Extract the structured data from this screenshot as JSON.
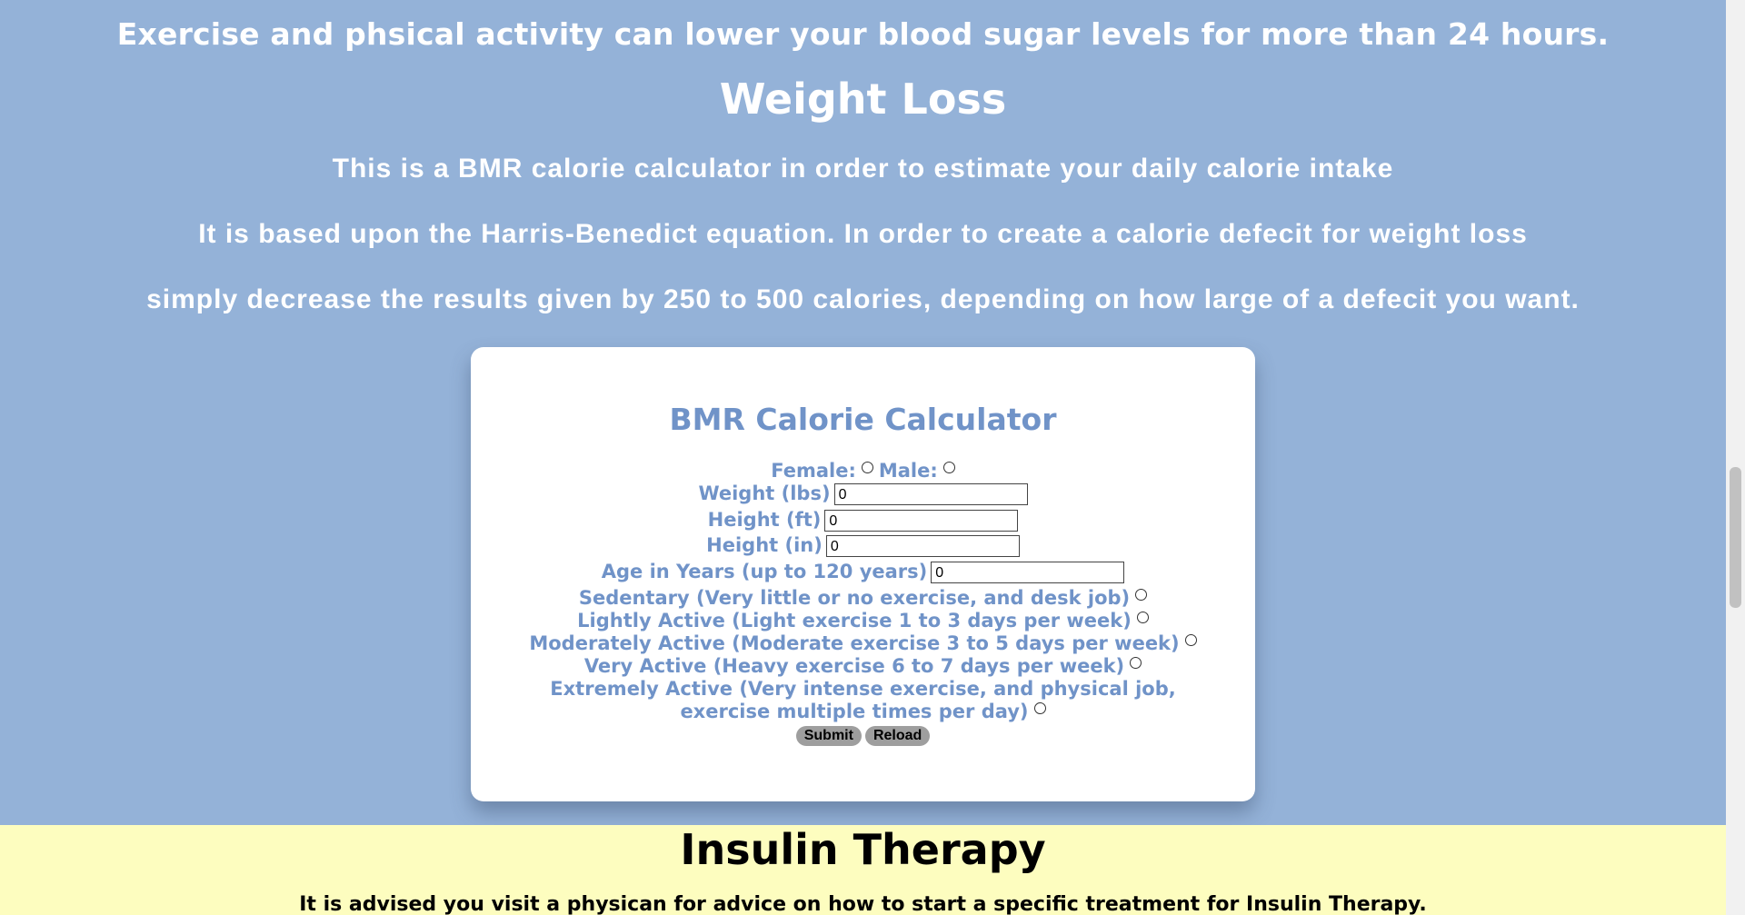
{
  "intro": {
    "exercise_text": "Exercise and phsical activity can lower your blood sugar levels for more than 24 hours."
  },
  "weight_loss": {
    "title": "Weight Loss",
    "line1": "This is a BMR calorie calculator in order to estimate your daily calorie intake",
    "line2": "It is based upon the Harris-Benedict equation. In order to create a calorie defecit for weight loss",
    "line3": "simply decrease the results given by 250 to 500 calories, depending on how large of a defecit you want."
  },
  "calculator": {
    "title": "BMR Calorie Calculator",
    "female_label": "Female:",
    "male_label": "Male:",
    "weight_label": "Weight (lbs)",
    "weight_value": "0",
    "height_ft_label": "Height (ft)",
    "height_ft_value": "0",
    "height_in_label": "Height (in)",
    "height_in_value": "0",
    "age_label": "Age in Years (up to 120 years)",
    "age_value": "0",
    "activity": {
      "sedentary": "Sedentary (Very little or no exercise, and desk job)",
      "light": "Lightly Active (Light exercise 1 to 3 days per week)",
      "moderate": "Moderately Active (Moderate exercise 3 to 5 days per week)",
      "very": "Very Active (Heavy exercise 6 to 7 days per week)",
      "extreme_line1": "Extremely Active (Very intense exercise, and physical job,",
      "extreme_line2": "exercise multiple times per day)"
    },
    "submit_label": "Submit",
    "reload_label": "Reload"
  },
  "insulin": {
    "title": "Insulin Therapy",
    "text": "It is advised you visit a physican for advice on how to start a specific treatment for Insulin Therapy."
  },
  "colors": {
    "blue_bg": "#94b2d8",
    "card_text": "#7093c8",
    "yellow_bg": "#fdfdbf"
  }
}
